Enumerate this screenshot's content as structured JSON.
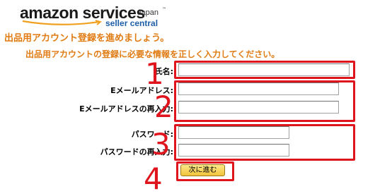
{
  "brand": {
    "logo_main": "amazon services",
    "logo_region": "Japan",
    "logo_tm": "™",
    "logo_sub": "seller central"
  },
  "page": {
    "heading": "出品用アカウント登録を進めましょう。",
    "subheading": "出品用アカウントの登録に必要な情報を正しく入力してください。"
  },
  "form": {
    "name_label": "氏名:",
    "name_value": "",
    "email_label": "Eメールアドレス:",
    "email_value": "",
    "email_confirm_label": "Eメールアドレスの再入力:",
    "email_confirm_value": "",
    "password_label": "パスワード:",
    "password_value": "",
    "password_confirm_label": "パスワードの再入力:",
    "password_confirm_value": "",
    "next_button": "次に進む"
  },
  "annotations": {
    "n1": "1",
    "n2": "2",
    "n3": "3",
    "n4": "4",
    "color": "#e0141c"
  },
  "colors": {
    "heading": "#e07b12",
    "logo_sub": "#1f5fa8",
    "button_top": "#fde98a",
    "button_bottom": "#f2c33c"
  }
}
